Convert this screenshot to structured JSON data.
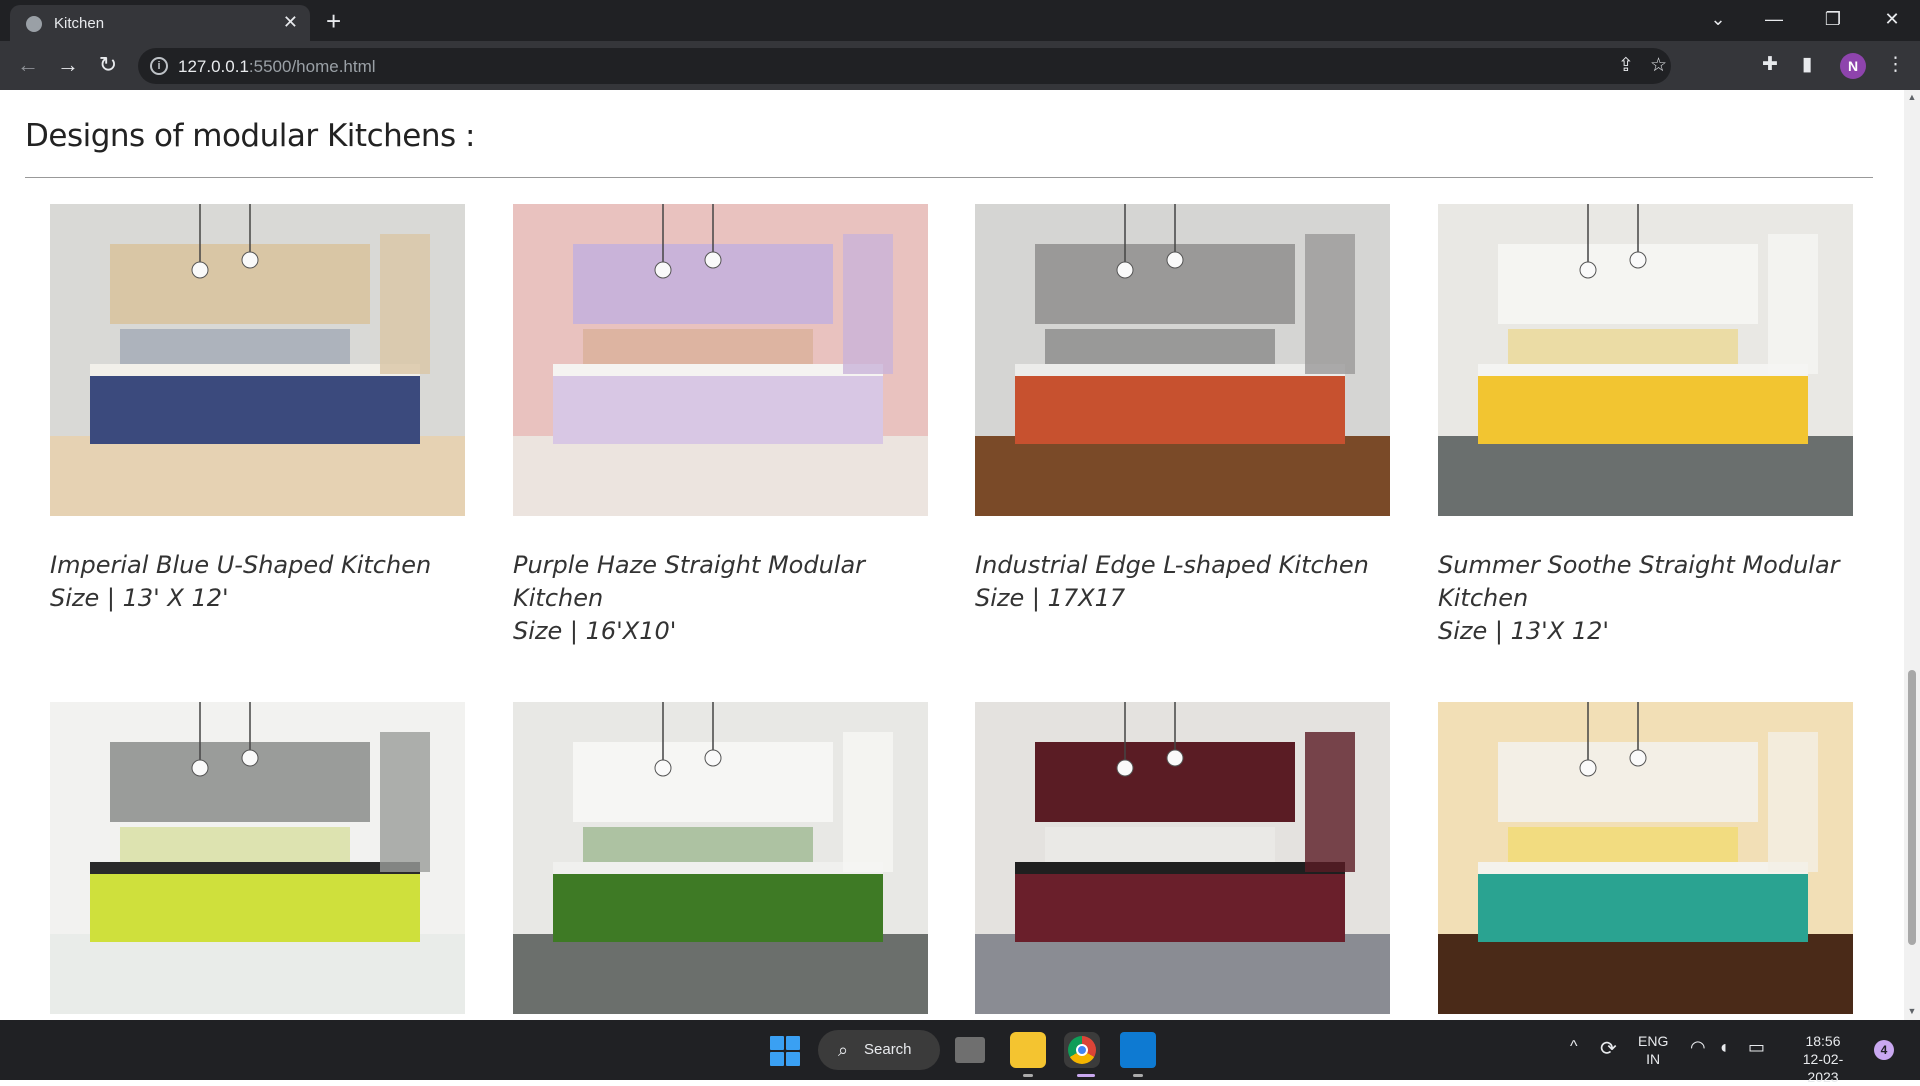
{
  "browser": {
    "tab_title": "Kitchen",
    "tab_close": "✕",
    "new_tab": "+",
    "url_host": "127.0.0.1",
    "url_rest": ":5500/home.html",
    "profile_initial": "N",
    "window_controls": {
      "minimize": "—",
      "restore": "❐",
      "close": "✕",
      "tab_search": "⌄"
    }
  },
  "page": {
    "heading": "Designs of modular Kitchens :",
    "cards": [
      {
        "title": "Imperial Blue U-Shaped Kitchen",
        "size": "Size | 13' X 12'",
        "palette": {
          "wall": "#d9d9d6",
          "cabinet": "#d9c6a5",
          "base": "#3b4a7d",
          "floor": "#e6d2b3",
          "counter": "#f2f0ea",
          "accent": "#5c6c8c"
        }
      },
      {
        "title": "Purple Haze Straight Modular Kitchen",
        "size": "Size | 16'X10'",
        "palette": {
          "wall": "#e9c2bf",
          "cabinet": "#c9b3d9",
          "base": "#d8c7e4",
          "floor": "#ece4df",
          "counter": "#f5f3f1",
          "accent": "#c89a6a"
        }
      },
      {
        "title": "Industrial Edge L-shaped Kitchen",
        "size": "Size | 17X17",
        "palette": {
          "wall": "#d5d5d3",
          "cabinet": "#9a9998",
          "base": "#c7512f",
          "floor": "#7a4a28",
          "counter": "#ececea",
          "accent": "#2b2b2b"
        }
      },
      {
        "title": "Summer Soothe Straight Modular Kitchen",
        "size": "Size | 13'X 12'",
        "palette": {
          "wall": "#e9e8e4",
          "cabinet": "#f5f5f2",
          "base": "#f2c531",
          "floor": "#6a6f6e",
          "counter": "#f4f4f2",
          "accent": "#f2c531"
        }
      },
      {
        "title": "",
        "size": "",
        "palette": {
          "wall": "#f2f2f0",
          "cabinet": "#9a9c9a",
          "base": "#cfe03c",
          "floor": "#e9ece9",
          "counter": "#2a2a2a",
          "accent": "#b7c83a"
        }
      },
      {
        "title": "",
        "size": "",
        "palette": {
          "wall": "#e8e8e5",
          "cabinet": "#f6f6f4",
          "base": "#3e7a25",
          "floor": "#6b6f6c",
          "counter": "#f0f0ee",
          "accent": "#3e7a25"
        }
      },
      {
        "title": "",
        "size": "",
        "palette": {
          "wall": "#e4e2df",
          "cabinet": "#5a1c24",
          "base": "#6a1f2b",
          "floor": "#8a8c93",
          "counter": "#1f1f1f",
          "accent": "#f5f5f3"
        }
      },
      {
        "title": "",
        "size": "",
        "palette": {
          "wall": "#f2dfb6",
          "cabinet": "#f3efe6",
          "base": "#2aa391",
          "floor": "#4a2a18",
          "counter": "#f4f2ec",
          "accent": "#f3d81c"
        }
      }
    ]
  },
  "taskbar": {
    "search_label": "Search",
    "lang_top": "ENG",
    "lang_bottom": "IN",
    "time": "18:56",
    "date": "12-02-2023",
    "notification_count": "4"
  }
}
